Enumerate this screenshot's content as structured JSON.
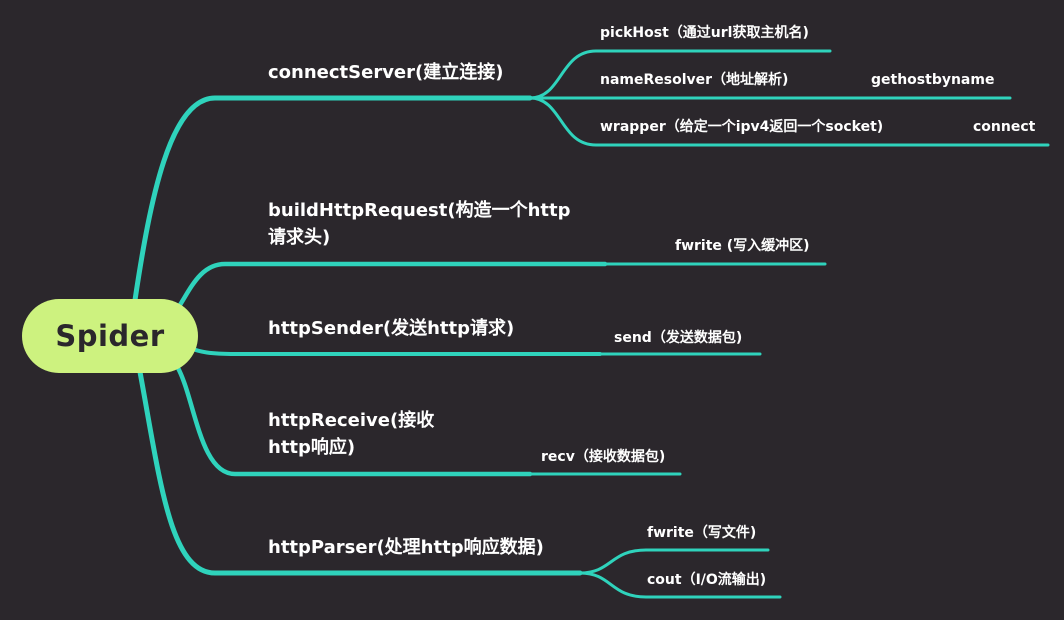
{
  "root": {
    "label": "Spider"
  },
  "branches": [
    {
      "label": "connectServer(建立连接)",
      "children": [
        {
          "label": "pickHost（通过url获取主机名)"
        },
        {
          "label": "nameResolver（地址解析)",
          "children": [
            {
              "label": "gethostbyname"
            }
          ]
        },
        {
          "label": "wrapper（给定一个ipv4返回一个socket)",
          "children": [
            {
              "label": "connect"
            }
          ]
        }
      ]
    },
    {
      "label_line1": "buildHttpRequest(构造一个http",
      "label_line2": "请求头)",
      "children": [
        {
          "label": "fwrite (写入缓冲区)"
        }
      ]
    },
    {
      "label": "httpSender(发送http请求)",
      "children": [
        {
          "label": "send（发送数据包)"
        }
      ]
    },
    {
      "label_line1": "httpReceive(接收",
      "label_line2": "http响应)",
      "children": [
        {
          "label": "recv（接收数据包)"
        }
      ]
    },
    {
      "label": "httpParser(处理http响应数据)",
      "children": [
        {
          "label": "fwrite（写文件)"
        },
        {
          "label": "cout（I/O流输出)"
        }
      ]
    }
  ],
  "colors": {
    "background": "#2b272c",
    "link": "#2fd3bc",
    "root_fill": "#cdf27f",
    "text": "#ffffff"
  }
}
